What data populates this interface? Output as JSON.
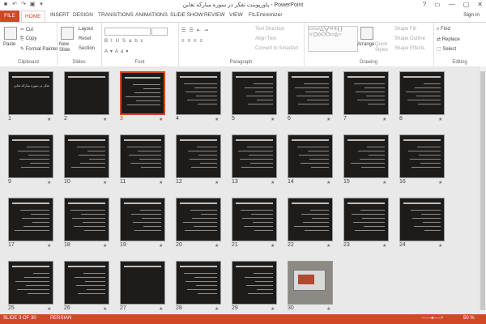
{
  "window": {
    "title": "پاورپوینت تفکر در سوره مبارکه تغابن - PowerPoint",
    "controls": [
      "?",
      "▭",
      "—",
      "▢",
      "✕"
    ]
  },
  "quick_access": [
    "save-icon",
    "undo-icon",
    "redo-icon",
    "present-icon",
    "customize-icon"
  ],
  "tabs": [
    "FILE",
    "HOME",
    "INSERT",
    "DESIGN",
    "TRANSITIONS",
    "ANIMATIONS",
    "SLIDE SHOW",
    "REVIEW",
    "VIEW",
    "FILEminimizer"
  ],
  "signin": "Sign in",
  "ribbon": {
    "clipboard": {
      "label": "Clipboard",
      "paste": "Paste",
      "cut": "Cut",
      "copy": "Copy",
      "format_painter": "Format Painter"
    },
    "slides": {
      "label": "Slides",
      "new_slide": "New Slide",
      "layout": "Layout",
      "reset": "Reset",
      "section": "Section"
    },
    "font": {
      "label": "Font"
    },
    "paragraph": {
      "label": "Paragraph",
      "text_direction": "Text Direction",
      "align_text": "Align Text",
      "convert": "Convert to SmartArt"
    },
    "drawing": {
      "label": "Drawing",
      "arrange": "Arrange",
      "quick_styles": "Quick Styles",
      "shape_fill": "Shape Fill",
      "shape_outline": "Shape Outline",
      "shape_effects": "Shape Effects"
    },
    "editing": {
      "label": "Editing",
      "find": "Find",
      "replace": "Replace",
      "select": "Select"
    }
  },
  "slides": [
    {
      "n": "1",
      "title": "تفکر در سوره مبارکه تغابن",
      "kind": "title"
    },
    {
      "n": "2",
      "title": "",
      "kind": "dark"
    },
    {
      "n": "3",
      "title": "",
      "kind": "text",
      "selected": true
    },
    {
      "n": "4",
      "title": "",
      "kind": "text"
    },
    {
      "n": "5",
      "title": "",
      "kind": "text"
    },
    {
      "n": "6",
      "title": "",
      "kind": "text"
    },
    {
      "n": "7",
      "title": "",
      "kind": "text"
    },
    {
      "n": "8",
      "title": "",
      "kind": "text"
    },
    {
      "n": "9",
      "title": "",
      "kind": "text"
    },
    {
      "n": "10",
      "title": "",
      "kind": "text"
    },
    {
      "n": "11",
      "title": "",
      "kind": "text"
    },
    {
      "n": "12",
      "title": "",
      "kind": "text"
    },
    {
      "n": "13",
      "title": "",
      "kind": "text"
    },
    {
      "n": "14",
      "title": "",
      "kind": "text"
    },
    {
      "n": "15",
      "title": "",
      "kind": "text"
    },
    {
      "n": "16",
      "title": "",
      "kind": "text"
    },
    {
      "n": "17",
      "title": "",
      "kind": "text"
    },
    {
      "n": "18",
      "title": "",
      "kind": "text"
    },
    {
      "n": "19",
      "title": "",
      "kind": "text"
    },
    {
      "n": "20",
      "title": "",
      "kind": "text"
    },
    {
      "n": "21",
      "title": "",
      "kind": "text"
    },
    {
      "n": "22",
      "title": "",
      "kind": "text"
    },
    {
      "n": "23",
      "title": "",
      "kind": "text"
    },
    {
      "n": "24",
      "title": "",
      "kind": "text"
    },
    {
      "n": "25",
      "title": "",
      "kind": "text"
    },
    {
      "n": "26",
      "title": "",
      "kind": "text"
    },
    {
      "n": "27",
      "title": "",
      "kind": "dark"
    },
    {
      "n": "28",
      "title": "",
      "kind": "text"
    },
    {
      "n": "29",
      "title": "",
      "kind": "text"
    },
    {
      "n": "30",
      "title": "",
      "kind": "photo"
    }
  ],
  "star_glyph": "★",
  "statusbar": {
    "slide_info": "SLIDE 3 OF 30",
    "language": "PERSIAN",
    "zoom": "50 %"
  },
  "colors": {
    "accent": "#d24726",
    "slide_bg": "#1e1c1a"
  }
}
